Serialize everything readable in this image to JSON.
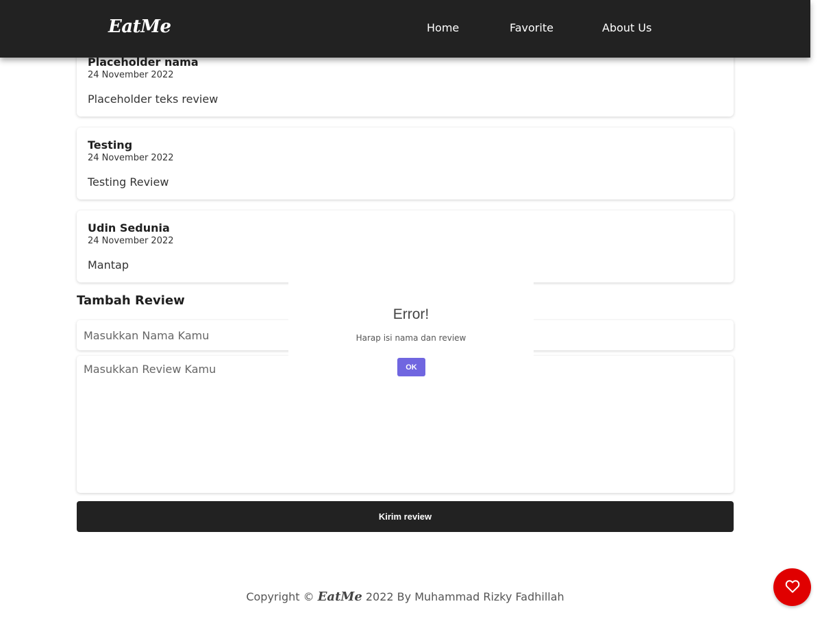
{
  "header": {
    "logo": "EatMe",
    "nav": [
      {
        "label": "Home"
      },
      {
        "label": "Favorite"
      },
      {
        "label": "About Us"
      }
    ]
  },
  "reviews": [
    {
      "name": "Placeholder nama",
      "date": "24 November 2022",
      "text": "Placeholder teks review"
    },
    {
      "name": "Testing",
      "date": "24 November 2022",
      "text": "Testing Review"
    },
    {
      "name": "Udin Sedunia",
      "date": "24 November 2022",
      "text": "Mantap"
    }
  ],
  "form": {
    "title": "Tambah Review",
    "name_placeholder": "Masukkan Nama Kamu",
    "name_value": "",
    "review_placeholder": "Masukkan Review Kamu",
    "review_value": "",
    "submit_label": "Kirim review"
  },
  "dialog": {
    "title": "Error!",
    "message": "Harap isi nama dan review",
    "ok_label": "OK",
    "ok_color": "#7066e0"
  },
  "footer": {
    "prefix": "Copyright ©",
    "brand": "EatMe",
    "suffix": "2022 By Muhammad Rizky Fadhillah"
  },
  "fab": {
    "icon": "heart-icon",
    "color": "#e00000"
  },
  "colors": {
    "header_bg": "#222222",
    "submit_bg": "#222222"
  }
}
